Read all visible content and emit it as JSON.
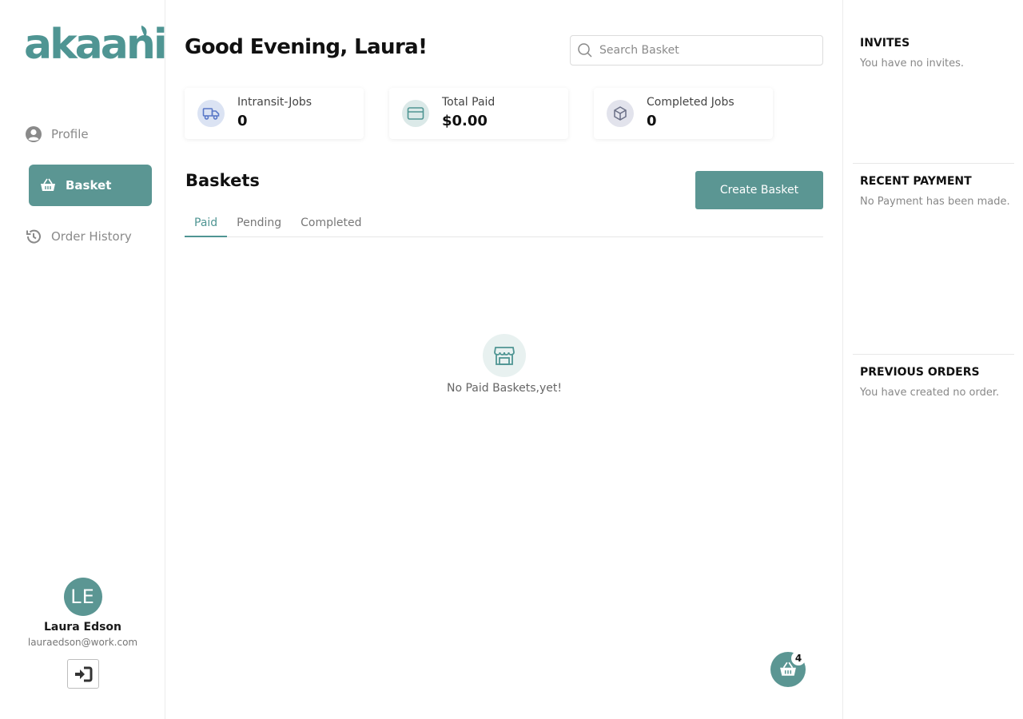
{
  "brand": {
    "name": "akaani",
    "accent": "#5b9693"
  },
  "sidebar": {
    "items": [
      {
        "label": "Profile",
        "icon": "user-circle-icon"
      },
      {
        "label": "Basket",
        "icon": "basket-icon"
      },
      {
        "label": "Order History",
        "icon": "history-icon"
      }
    ],
    "user": {
      "initials": "LE",
      "name": "Laura Edson",
      "email": "lauraedson@work.com"
    }
  },
  "header": {
    "greeting": "Good Evening, Laura!",
    "search_placeholder": "Search Basket"
  },
  "stats": [
    {
      "label": "Intransit-Jobs",
      "value": "0",
      "icon": "truck-icon"
    },
    {
      "label": "Total Paid",
      "value": "$0.00",
      "icon": "credit-card-icon"
    },
    {
      "label": "Completed Jobs",
      "value": "0",
      "icon": "package-icon"
    }
  ],
  "baskets": {
    "title": "Baskets",
    "create_label": "Create Basket",
    "tabs": [
      "Paid",
      "Pending",
      "Completed"
    ],
    "active_tab": "Paid",
    "empty_text": "No Paid Baskets,yet!"
  },
  "fab": {
    "badge": "4"
  },
  "right": {
    "invites": {
      "title": "INVITES",
      "text": "You have no invites."
    },
    "payment": {
      "title": "RECENT PAYMENT",
      "text": "No Payment has been made."
    },
    "orders": {
      "title": "PREVIOUS ORDERS",
      "text": "You have created no order."
    }
  }
}
